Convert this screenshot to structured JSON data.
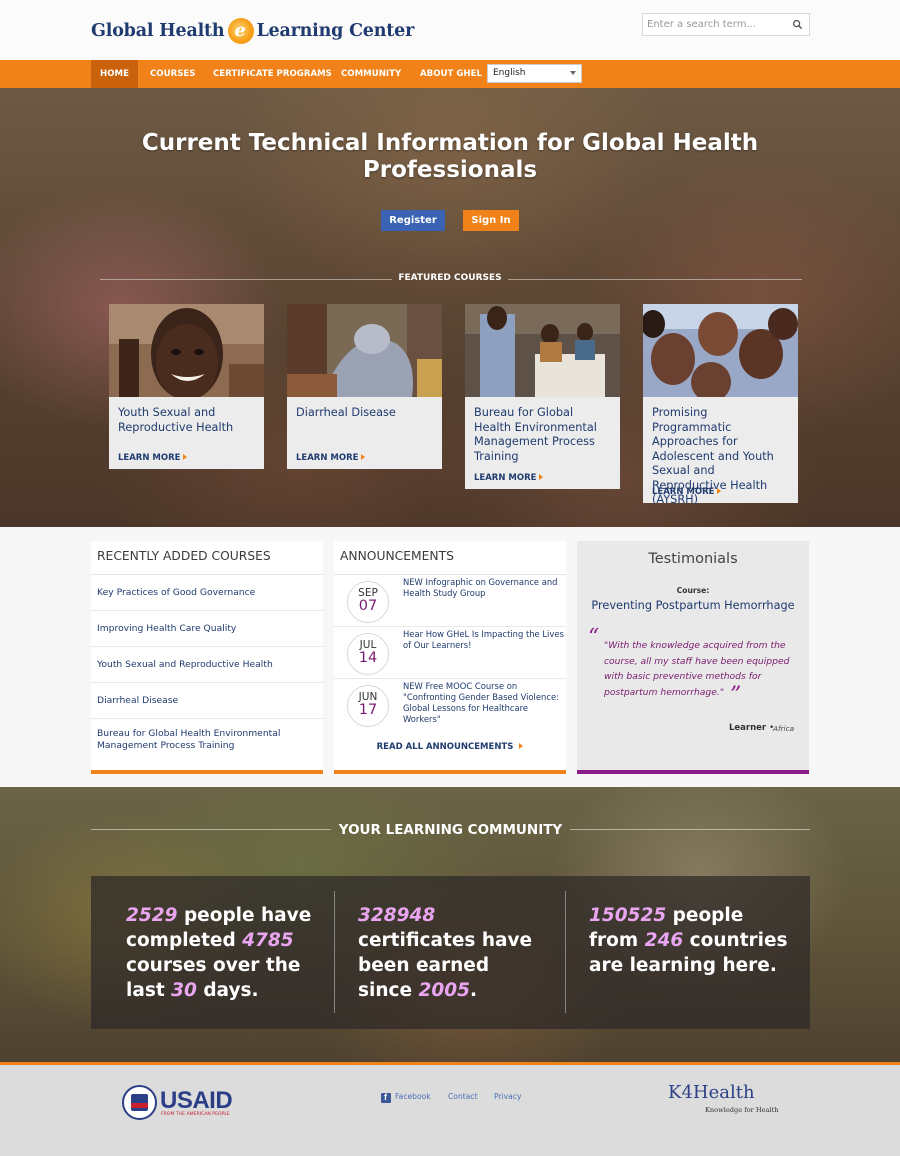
{
  "header": {
    "logo_left": "Global Health",
    "logo_mark": "e",
    "logo_right": "Learning Center",
    "search_placeholder": "Enter a search term..."
  },
  "nav": {
    "items": [
      "HOME",
      "COURSES",
      "CERTIFICATE PROGRAMS",
      "COMMUNITY",
      "ABOUT GHEL"
    ],
    "active": "HOME",
    "language": "English"
  },
  "hero": {
    "title_line1": "Current Technical Information for Global Health",
    "title_line2": "Professionals",
    "register_label": "Register",
    "signin_label": "Sign In",
    "featured_title": "FEATURED COURSES",
    "cards": [
      {
        "title": "Youth Sexual and Reproductive Health",
        "more": "LEARN MORE"
      },
      {
        "title": "Diarrheal Disease",
        "more": "LEARN MORE"
      },
      {
        "title": "Bureau for Global Health Environmental Management Process Training",
        "more": "LEARN MORE"
      },
      {
        "title": "Promising Programmatic Approaches for Adolescent and Youth Sexual and Reproductive Health (AYSRH)",
        "more": "LEARN MORE"
      }
    ]
  },
  "recent": {
    "title": "RECENTLY ADDED COURSES",
    "items": [
      "Key Practices of Good Governance",
      "Improving Health Care Quality",
      "Youth Sexual and Reproductive Health",
      "Diarrheal Disease",
      "Bureau for Global Health Environmental Management Process Training"
    ]
  },
  "announcements": {
    "title": "ANNOUNCEMENTS",
    "items": [
      {
        "month": "SEP",
        "day": "07",
        "text": "NEW Infographic on Governance and Health Study Group"
      },
      {
        "month": "JUL",
        "day": "14",
        "text": "Hear How GHeL Is Impacting the Lives of Our Learners!"
      },
      {
        "month": "JUN",
        "day": "17",
        "text": "NEW Free MOOC Course on \"Confronting Gender Based Violence: Global Lessons for Healthcare Workers\""
      }
    ],
    "read_all": "READ ALL ANNOUNCEMENTS"
  },
  "testimonials": {
    "title": "Testimonials",
    "course_label": "Course:",
    "course": "Preventing Postpartum Hemorrhage",
    "quote": "\"With the knowledge acquired from the course, all my staff have been equipped with basic preventive methods for postpartum hemorrhage.\"",
    "learner": "Learner",
    "location": "Africa"
  },
  "community": {
    "title": "YOUR LEARNING COMMUNITY",
    "stat1": {
      "n1": "2529",
      "t1": " people have completed ",
      "n2": "4785",
      "t2": " courses over the last ",
      "n3": "30",
      "t3": " days."
    },
    "stat2": {
      "n1": "328948",
      "t1": " certificates have been earned since ",
      "n2": "2005",
      "t2": "."
    },
    "stat3": {
      "n1": "150525",
      "t1": " people from ",
      "n2": "246",
      "t2": " countries are learning here."
    }
  },
  "footer": {
    "usaid": "USAID",
    "usaid_sub": "FROM THE AMERICAN PEOPLE",
    "links": [
      "Facebook",
      "Contact",
      "Privacy"
    ],
    "k4health": "K4Health",
    "k4health_sub": "Knowledge for Health"
  },
  "colors": {
    "brand_orange": "#f08219",
    "brand_navy": "#1f3b6f",
    "accent_purple": "#8b1d8b",
    "highlight_pink": "#e9a5ef",
    "register_blue": "#3a63b4"
  }
}
